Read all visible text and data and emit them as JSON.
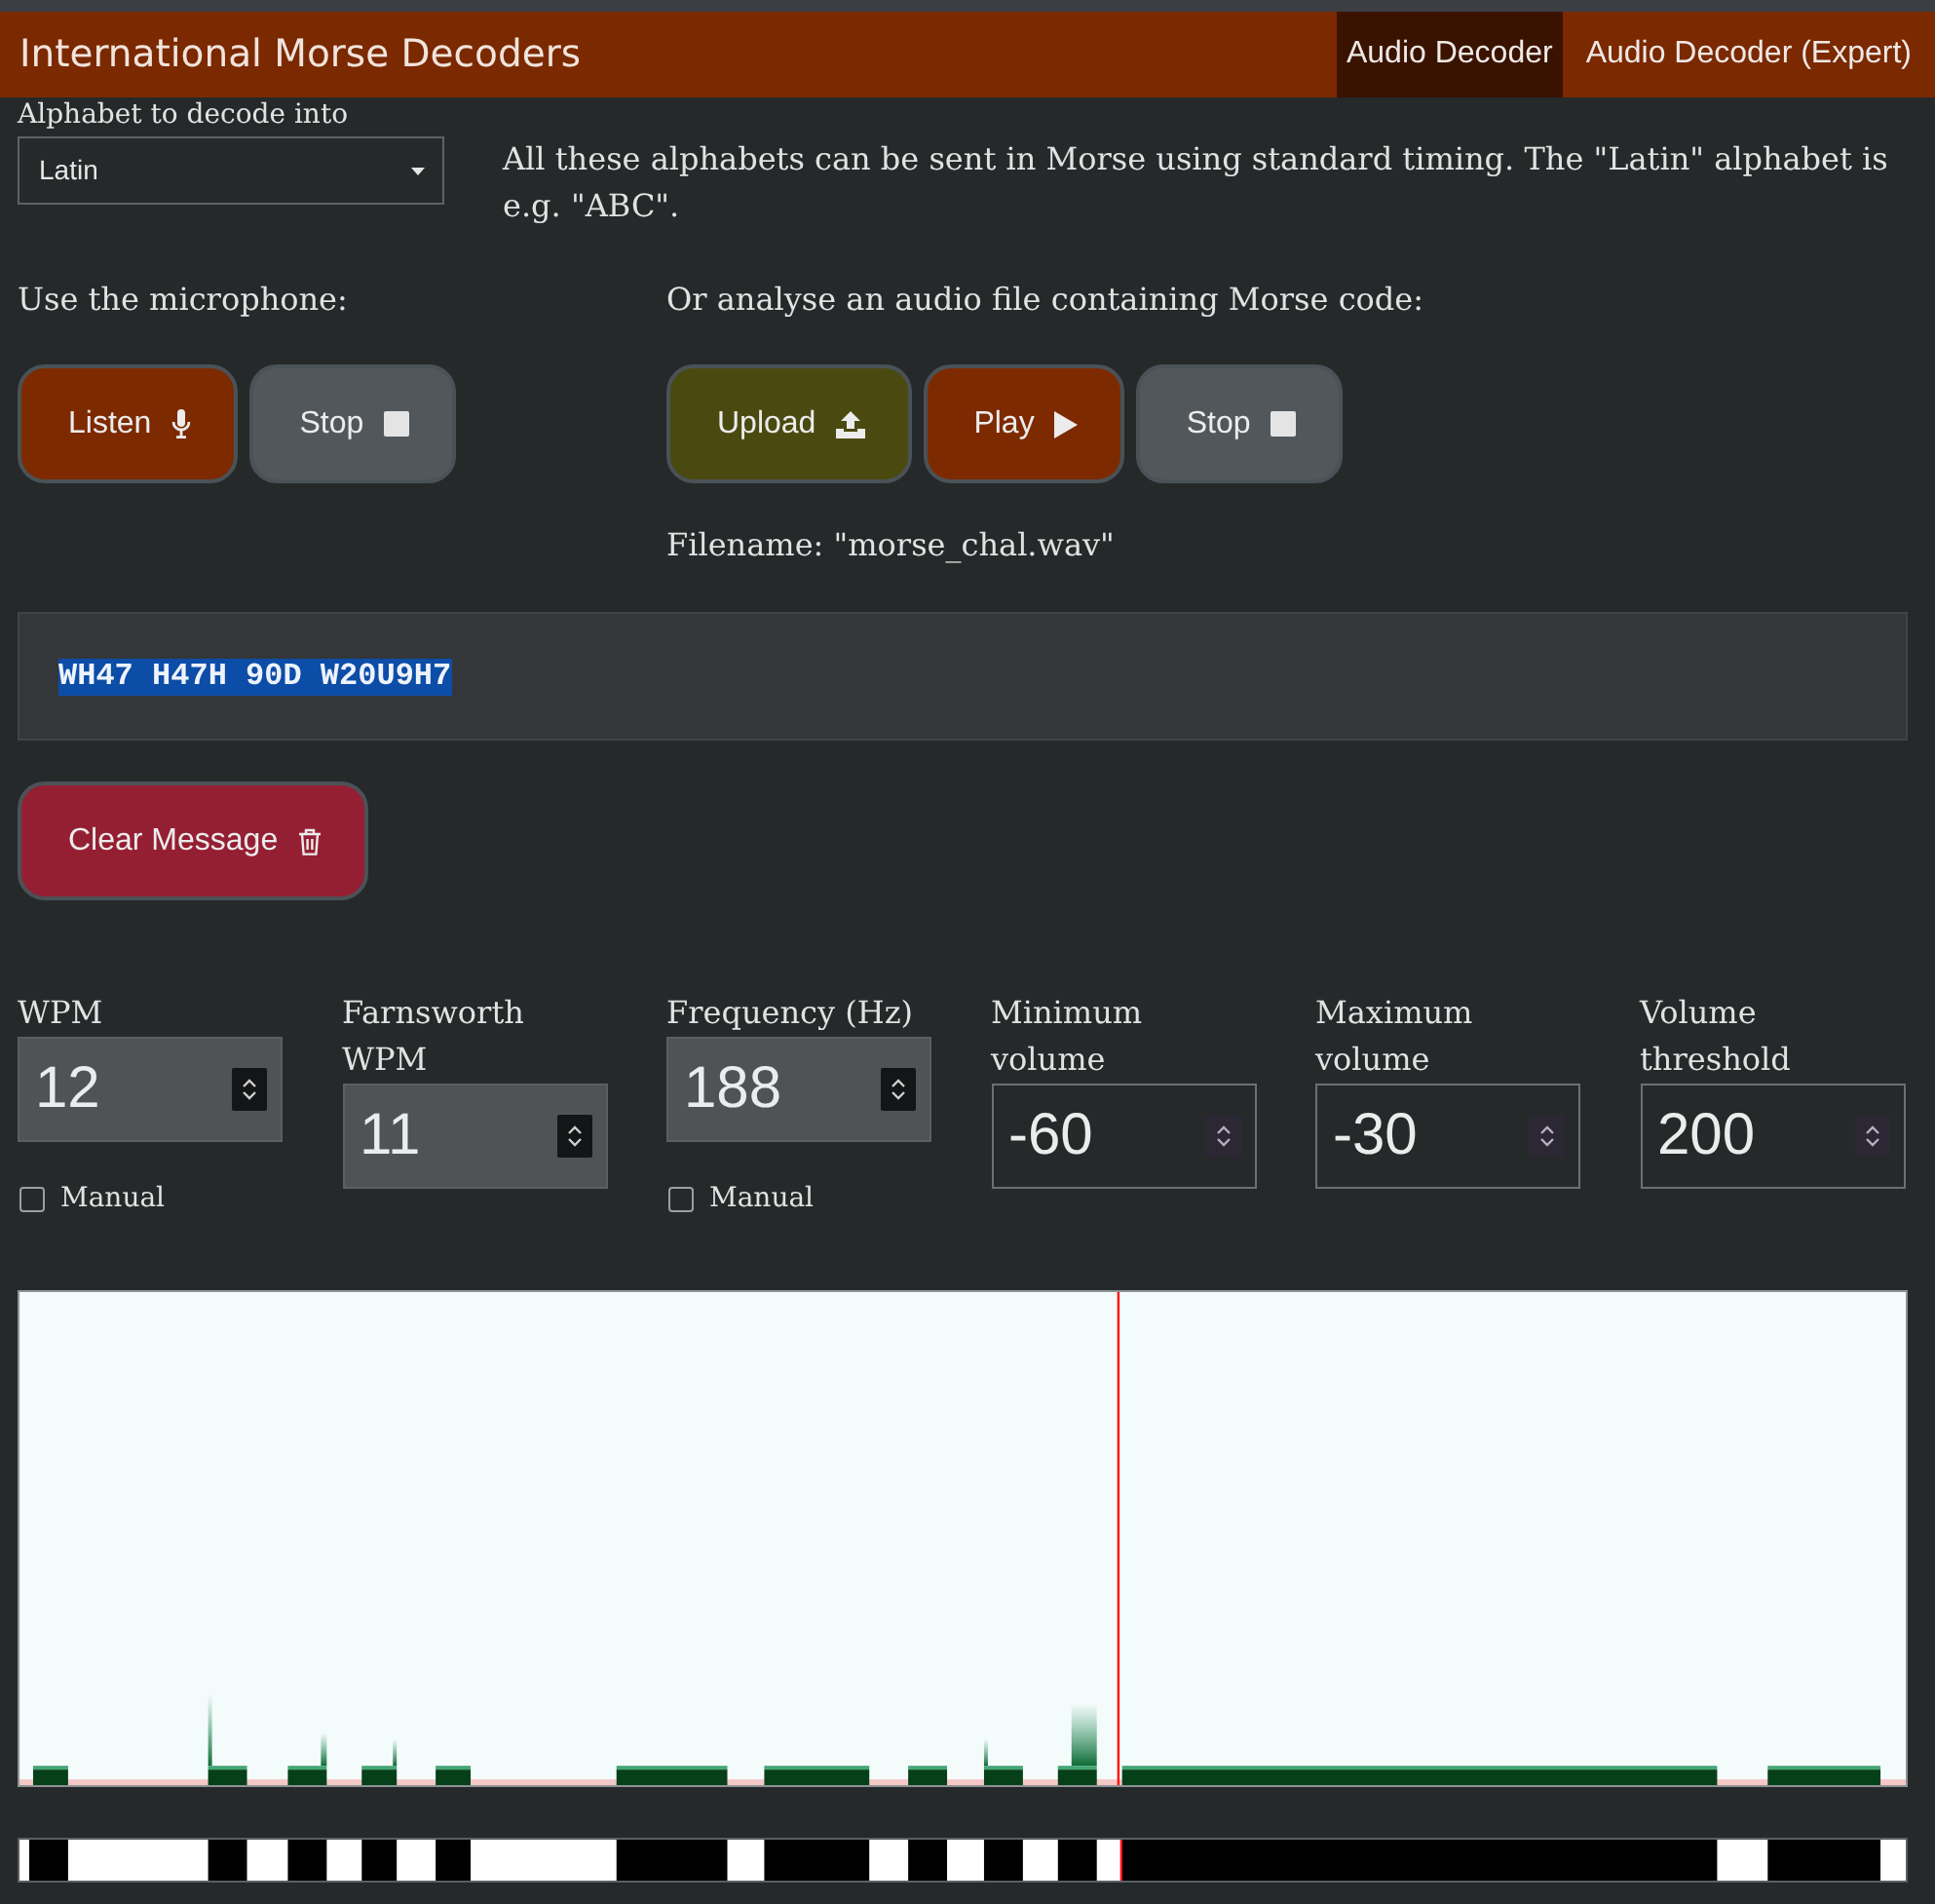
{
  "navbar": {
    "title": "International Morse Decoders",
    "tabs": [
      {
        "label": "Audio Decoder",
        "selected": true
      },
      {
        "label": "Audio Decoder (Expert)",
        "selected": false
      }
    ]
  },
  "alphabet": {
    "label": "Alphabet to decode into",
    "value": "Latin",
    "description": "All these alphabets can be sent in Morse using standard timing. The \"Latin\" alphabet is e.g. \"ABC\"."
  },
  "microphone": {
    "heading": "Use the microphone:",
    "buttons": [
      {
        "label": "Listen",
        "kind": "listen"
      },
      {
        "label": "Stop",
        "kind": "stop"
      }
    ]
  },
  "audio_file": {
    "heading": "Or analyse an audio file containing Morse code:",
    "buttons": [
      {
        "label": "Upload",
        "kind": "upload"
      },
      {
        "label": "Play",
        "kind": "play"
      },
      {
        "label": "Stop",
        "kind": "stop"
      }
    ],
    "filename": "Filename: \"morse_chal.wav\""
  },
  "message": {
    "text": "WH47 H47H 90D W20U9H7",
    "selected": true
  },
  "clear_button": {
    "label": "Clear Message"
  },
  "settings": [
    {
      "label": "WPM",
      "value": "12",
      "disabled": true,
      "manual": {
        "label": "Manual",
        "checked": false
      }
    },
    {
      "label": "Farnsworth WPM",
      "value": "11",
      "disabled": true
    },
    {
      "label": "Frequency (Hz)",
      "value": "188",
      "disabled": true,
      "manual": {
        "label": "Manual",
        "checked": false
      }
    },
    {
      "label": "Minimum volume",
      "value": "-60",
      "disabled": false
    },
    {
      "label": "Maximum volume",
      "value": "-30",
      "disabled": false
    },
    {
      "label": "Volume threshold",
      "value": "200",
      "disabled": false
    }
  ]
}
